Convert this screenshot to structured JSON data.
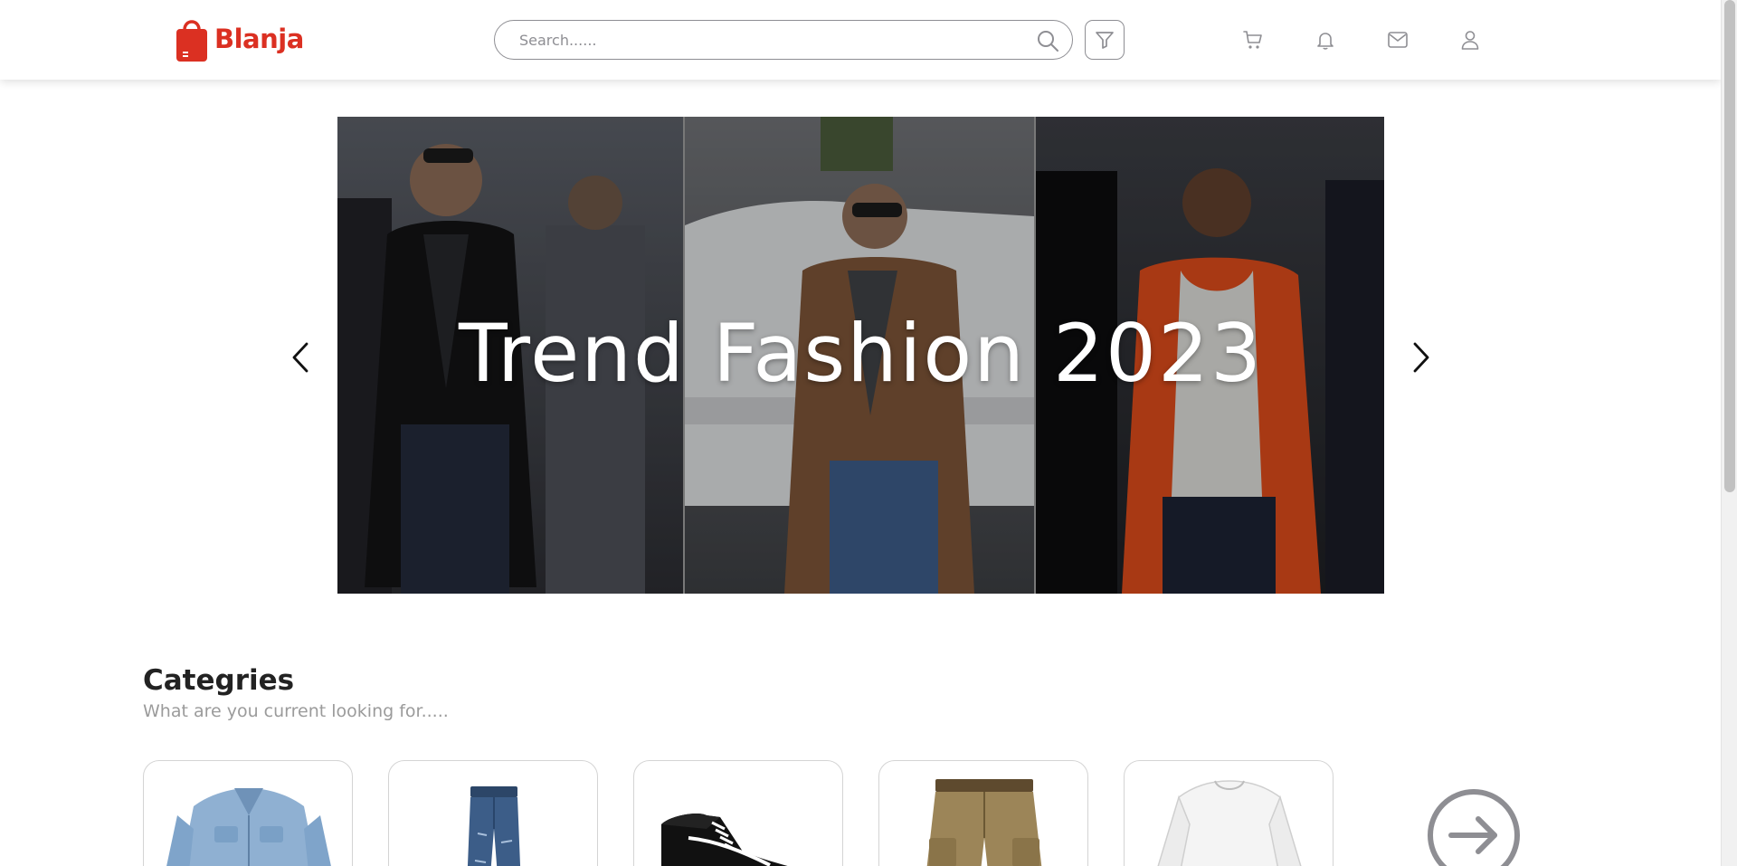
{
  "app": {
    "brand": "Blanja",
    "brand_color": "#DB3022"
  },
  "header": {
    "search": {
      "placeholder": "Search......",
      "value": ""
    },
    "icons": [
      "search-icon",
      "filter-icon",
      "cart-icon",
      "bell-icon",
      "mail-icon",
      "user-icon"
    ]
  },
  "banner": {
    "headline": "Trend Fashion 2023",
    "prev_icon": "chevron-left-icon",
    "next_icon": "chevron-right-icon"
  },
  "categories": {
    "title": "Categries",
    "subtitle": "What are you current looking for.....",
    "items": [
      {
        "icon": "denim-jacket-image"
      },
      {
        "icon": "jeans-image"
      },
      {
        "icon": "high-top-sneaker-image"
      },
      {
        "icon": "cargo-shorts-image"
      },
      {
        "icon": "sweatshirt-image"
      }
    ],
    "more_icon": "arrow-right-circle-icon"
  }
}
